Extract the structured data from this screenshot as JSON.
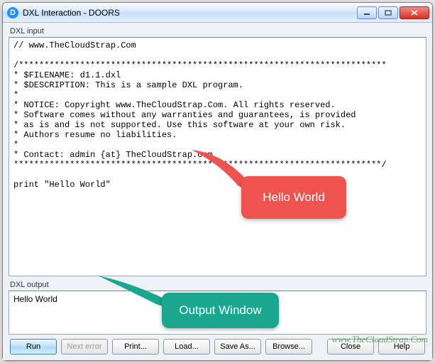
{
  "titlebar": {
    "icon_letter": "D",
    "title": "DXL Interaction - DOORS"
  },
  "labels": {
    "input": "DXL input",
    "output": "DXL output"
  },
  "input_code": "// www.TheCloudStrap.Com\n\n/************************************************************************\n* $FILENAME: d1.1.dxl\n* $DESCRIPTION: This is a sample DXL program.\n*\n* NOTICE: Copyright www.TheCloudStrap.Com. All rights reserved.\n* Software comes without any warranties and guarantees, is provided\n* as is and is not supported. Use this software at your own risk.\n* Authors resume no liabilities.\n*\n* Contact: admin {at} TheCloudStrap.com\n************************************************************************/\n\nprint \"Hello World\"",
  "output_text": "Hello World",
  "buttons": {
    "run": "Run",
    "next_error": "Next error",
    "print": "Print...",
    "load": "Load...",
    "save_as": "Save As...",
    "browse": "Browse...",
    "close": "Close",
    "help": "Help"
  },
  "callouts": {
    "red": "Hello World",
    "green": "Output Window"
  },
  "watermark": "www.TheCloudStrap.Com"
}
